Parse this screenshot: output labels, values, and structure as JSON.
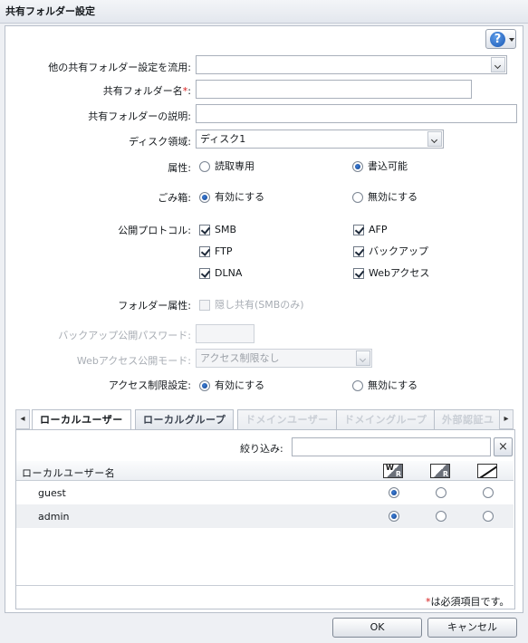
{
  "window": {
    "title": "共有フォルダー設定"
  },
  "form": {
    "copy_from": {
      "label": "他の共有フォルダー設定を流用:",
      "value": ""
    },
    "name": {
      "label": "共有フォルダー名",
      "required_mark": "*",
      "colon": ":",
      "value": ""
    },
    "description": {
      "label": "共有フォルダーの説明:",
      "value": ""
    },
    "disk_area": {
      "label": "ディスク領域:",
      "value": "ディスク1"
    },
    "attribute": {
      "label": "属性:",
      "options": [
        {
          "label": "読取専用",
          "selected": false
        },
        {
          "label": "書込可能",
          "selected": true
        }
      ]
    },
    "recycle_bin": {
      "label": "ごみ箱:",
      "options": [
        {
          "label": "有効にする",
          "selected": true
        },
        {
          "label": "無効にする",
          "selected": false
        }
      ]
    },
    "protocols": {
      "label": "公開プロトコル:",
      "items": [
        {
          "label": "SMB",
          "checked": true
        },
        {
          "label": "AFP",
          "checked": true
        },
        {
          "label": "FTP",
          "checked": true
        },
        {
          "label": "バックアップ",
          "checked": true
        },
        {
          "label": "DLNA",
          "checked": true
        },
        {
          "label": "Webアクセス",
          "checked": true
        }
      ]
    },
    "folder_attribute": {
      "label": "フォルダー属性:",
      "option": "隠し共有(SMBのみ)",
      "checked": false,
      "disabled": true
    },
    "backup_password": {
      "label": "バックアップ公開パスワード:",
      "value": "",
      "disabled": true
    },
    "web_access_mode": {
      "label": "Webアクセス公開モード:",
      "value": "アクセス制限なし",
      "disabled": true
    },
    "access_restriction": {
      "label": "アクセス制限設定:",
      "options": [
        {
          "label": "有効にする",
          "selected": true
        },
        {
          "label": "無効にする",
          "selected": false
        }
      ]
    }
  },
  "tabs": [
    {
      "label": "ローカルユーザー",
      "active": true,
      "disabled": false
    },
    {
      "label": "ローカルグループ",
      "active": false,
      "disabled": false
    },
    {
      "label": "ドメインユーザー",
      "active": false,
      "disabled": true
    },
    {
      "label": "ドメイングループ",
      "active": false,
      "disabled": true
    },
    {
      "label": "外部認証ユ",
      "active": false,
      "disabled": true
    }
  ],
  "tab_arrows": {
    "left": "◂",
    "right": "▸"
  },
  "filter": {
    "label": "絞り込み:",
    "value": "",
    "clear_icon": "×"
  },
  "user_table": {
    "header": "ローカルユーザー名",
    "columns": [
      {
        "icon": "read-write-icon",
        "w": "W",
        "r": "R"
      },
      {
        "icon": "read-only-icon",
        "r": "R"
      },
      {
        "icon": "no-access-icon"
      }
    ],
    "rows": [
      {
        "name": "guest",
        "permission": 0
      },
      {
        "name": "admin",
        "permission": 0
      }
    ]
  },
  "footnote": {
    "mark": "*",
    "text": "は必須項目です。"
  },
  "buttons": {
    "ok": "OK",
    "cancel": "キャンセル"
  },
  "help": {
    "glyph": "?"
  }
}
